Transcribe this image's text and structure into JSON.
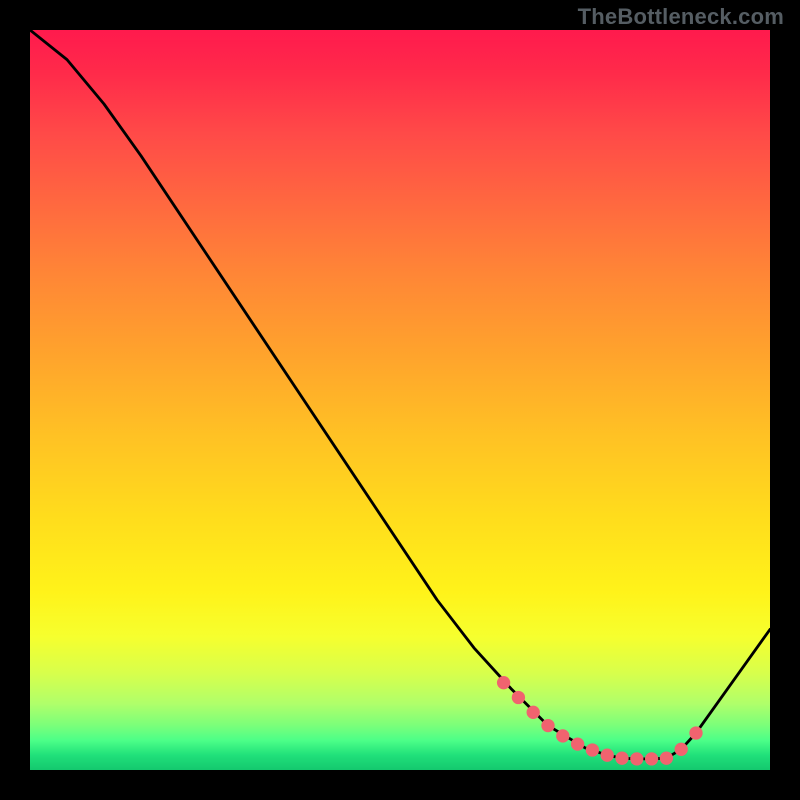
{
  "brand": "TheBottleneck.com",
  "colors": {
    "curve": "#000000",
    "marker": "#f0636f"
  },
  "chart_data": {
    "type": "line",
    "title": "",
    "xlabel": "",
    "ylabel": "",
    "xlim": [
      0,
      100
    ],
    "ylim": [
      0,
      100
    ],
    "x": [
      0,
      5,
      10,
      15,
      20,
      25,
      30,
      35,
      40,
      45,
      50,
      55,
      60,
      65,
      70,
      75,
      78,
      80,
      82,
      84,
      86,
      88,
      90,
      95,
      100
    ],
    "y": [
      100,
      96,
      90,
      83,
      75.5,
      68,
      60.5,
      53,
      45.5,
      38,
      30.5,
      23,
      16.5,
      11,
      6,
      3,
      2,
      1.6,
      1.5,
      1.5,
      1.6,
      2.8,
      5,
      12,
      19
    ],
    "optimal_markers_x": [
      64,
      66,
      68,
      70,
      72,
      74,
      76,
      78,
      80,
      82,
      84,
      86,
      88,
      90
    ],
    "optimal_markers_y": [
      11.8,
      9.8,
      7.8,
      6,
      4.6,
      3.5,
      2.7,
      2,
      1.6,
      1.5,
      1.5,
      1.6,
      2.8,
      5
    ]
  }
}
